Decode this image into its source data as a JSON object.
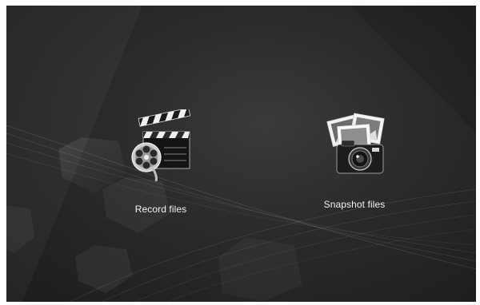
{
  "menu": {
    "items": [
      {
        "label": "Record files",
        "icon": "clapperboard-film-reel-icon"
      },
      {
        "label": "Snapshot files",
        "icon": "camera-photos-icon"
      }
    ]
  },
  "colors": {
    "background": "#262626",
    "label": "#f2f2f2"
  }
}
